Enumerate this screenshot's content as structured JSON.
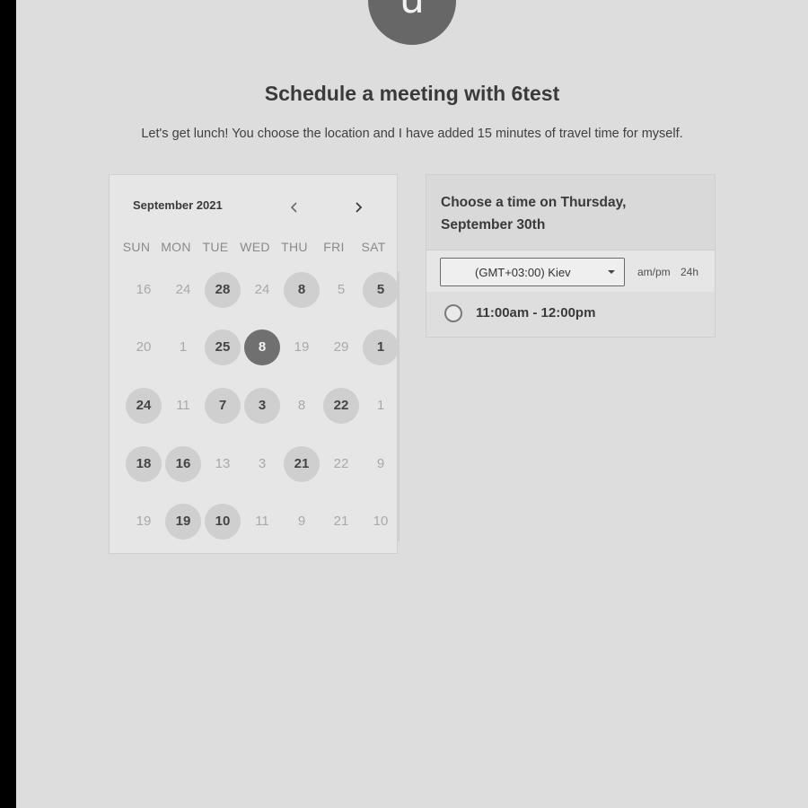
{
  "avatar": {
    "initial": "u"
  },
  "header": {
    "title": "Schedule a meeting with 6test",
    "subtitle": "Let's get lunch! You choose the location and I have added 15 minutes of travel time for myself."
  },
  "calendar": {
    "month_label": "September 2021",
    "prev_icon": "chevron-left-icon",
    "next_icon": "chevron-right-icon",
    "weekdays": [
      "SUN",
      "MON",
      "TUE",
      "WED",
      "THU",
      "FRI",
      "SAT"
    ],
    "weeks": [
      [
        {
          "day": "16",
          "state": "muted"
        },
        {
          "day": "24",
          "state": "muted"
        },
        {
          "day": "28",
          "state": "avail"
        },
        {
          "day": "24",
          "state": "muted"
        },
        {
          "day": "8",
          "state": "avail"
        },
        {
          "day": "5",
          "state": "muted"
        },
        {
          "day": "5",
          "state": "avail"
        }
      ],
      [
        {
          "day": "20",
          "state": "muted"
        },
        {
          "day": "1",
          "state": "muted"
        },
        {
          "day": "25",
          "state": "avail"
        },
        {
          "day": "8",
          "state": "selected"
        },
        {
          "day": "19",
          "state": "muted"
        },
        {
          "day": "29",
          "state": "muted"
        },
        {
          "day": "1",
          "state": "avail"
        }
      ],
      [
        {
          "day": "24",
          "state": "avail"
        },
        {
          "day": "11",
          "state": "muted"
        },
        {
          "day": "7",
          "state": "avail"
        },
        {
          "day": "3",
          "state": "avail"
        },
        {
          "day": "8",
          "state": "muted"
        },
        {
          "day": "22",
          "state": "avail"
        },
        {
          "day": "1",
          "state": "muted"
        }
      ],
      [
        {
          "day": "18",
          "state": "avail"
        },
        {
          "day": "16",
          "state": "avail"
        },
        {
          "day": "13",
          "state": "muted"
        },
        {
          "day": "3",
          "state": "muted"
        },
        {
          "day": "21",
          "state": "avail"
        },
        {
          "day": "22",
          "state": "muted"
        },
        {
          "day": "9",
          "state": "muted"
        }
      ],
      [
        {
          "day": "19",
          "state": "muted"
        },
        {
          "day": "19",
          "state": "avail"
        },
        {
          "day": "10",
          "state": "avail"
        },
        {
          "day": "11",
          "state": "muted"
        },
        {
          "day": "9",
          "state": "muted"
        },
        {
          "day": "21",
          "state": "muted"
        },
        {
          "day": "10",
          "state": "muted"
        }
      ]
    ]
  },
  "time_panel": {
    "heading": "Choose a time on Thursday, September 30th",
    "timezone": "(GMT+03:00) Kiev",
    "format_ampm": "am/pm",
    "format_24h": "24h",
    "slots": [
      {
        "label": "11:00am - 12:00pm"
      }
    ]
  },
  "colors": {
    "background": "#dddddd",
    "avatar": "#676767",
    "selected_day": "#707070",
    "available_day": "#cfcfcf"
  }
}
